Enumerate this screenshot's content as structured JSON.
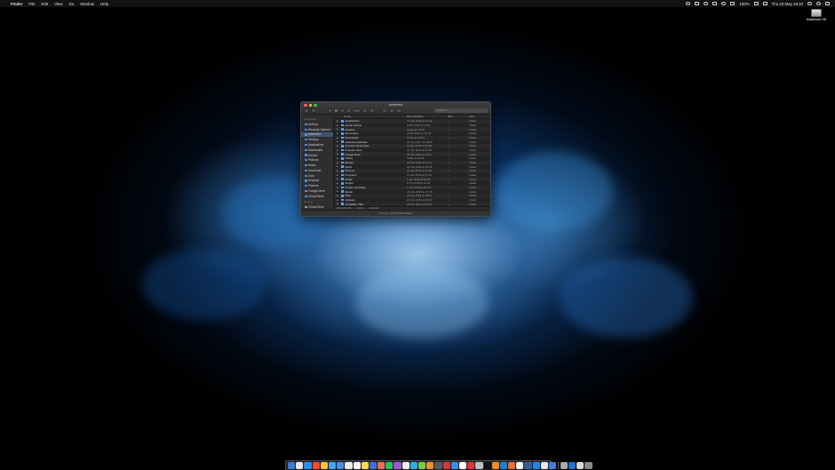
{
  "menubar": {
    "items": [
      "Finder",
      "File",
      "Edit",
      "View",
      "Go",
      "Window",
      "Help"
    ],
    "battery": "100%",
    "datetime": "Thu 23 May 18:10"
  },
  "desktop": {
    "drive_label": "Macintosh HD"
  },
  "finder": {
    "title": "abmerfert",
    "search_placeholder": "Search",
    "sidebar": {
      "favorites_label": "Favourites",
      "favorites": [
        "AirDrop",
        "Recently Opened",
        "abmerfert",
        "Desktop",
        "Applications",
        "Downloads",
        "Movies",
        "Pictures",
        "Music",
        "Download",
        "Dust",
        "Dropbox",
        "Pictures",
        "Google Drive",
        "iCloud Drive"
      ],
      "devices_label": "Devices",
      "devices": [
        "iCloud Drive",
        "Macintosh HD"
      ],
      "selected_index": 2
    },
    "columns": {
      "name": "Name",
      "date": "Date Modified",
      "size": "Size",
      "kind": "Kind"
    },
    "rows": [
      {
        "name": "Applications",
        "date": "17 Aug 2018 at 12:10",
        "size": "--",
        "kind": "Folder"
      },
      {
        "name": "Adobe Scripts",
        "date": "8 Mar 2019 at 10:37",
        "size": "--",
        "kind": "Folder"
      },
      {
        "name": "Desktop",
        "date": "Today at 18:03",
        "size": "--",
        "kind": "Folder"
      },
      {
        "name": "Documents",
        "date": "3 Mar 2019 at 11:18",
        "size": "--",
        "kind": "Folder"
      },
      {
        "name": "Downloads",
        "date": "Today at 18:04",
        "size": "--",
        "kind": "Folder"
      },
      {
        "name": "android-certificates",
        "date": "24 Sep 2017 at 18:03",
        "size": "--",
        "kind": "Folder"
      },
      {
        "name": "Creative Cloud Files",
        "date": "15 Apr 2018 at 22:59",
        "size": "--",
        "kind": "Folder"
      },
      {
        "name": "R Studio docs",
        "date": "21 Jan 2019 at 13:40",
        "size": "--",
        "kind": "Folder"
      },
      {
        "name": "Google Drive",
        "date": "25 Apr 2019 at 14:21",
        "size": "--",
        "kind": "Folder"
      },
      {
        "name": "Library",
        "date": "Today at 11:03",
        "size": "--",
        "kind": "Folder"
      },
      {
        "name": "Movies",
        "date": "23 Oct 2018 at 16:11",
        "size": "--",
        "kind": "Folder"
      },
      {
        "name": "Music",
        "date": "22 Feb 2019 at 10:28",
        "size": "--",
        "kind": "Folder"
      },
      {
        "name": "Pictures",
        "date": "19 Apr 2019 at 13:43",
        "size": "--",
        "kind": "Folder"
      },
      {
        "name": "Programs",
        "date": "11 Jan 2019 at 17:32",
        "size": "--",
        "kind": "Folder"
      },
      {
        "name": "Public",
        "date": "1 Apr 2018 at 20:09",
        "size": "--",
        "kind": "Folder"
      },
      {
        "name": "Scripts",
        "date": "8 Oct 2018 at 12:10",
        "size": "--",
        "kind": "Folder"
      },
      {
        "name": "Screen recording",
        "date": "3 Jan 2019 at 23:19",
        "size": "--",
        "kind": "Folder"
      },
      {
        "name": "Server",
        "date": "23 Feb 2019 at 17:15",
        "size": "--",
        "kind": "Folder"
      },
      {
        "name": "Sites",
        "date": "19 Apr 2019 at 18:02",
        "size": "--",
        "kind": "Folder"
      },
      {
        "name": "snippets",
        "date": "21 Nov 2018 at 09:40",
        "size": "--",
        "kind": "Folder"
      },
      {
        "name": "VirtualBox VMs",
        "date": "20 Jan 2019 at 09:31",
        "size": "--",
        "kind": "Folder"
      }
    ],
    "pathbar": [
      "Macintosh HD",
      "Users",
      "abmerfert"
    ],
    "status": "21 items, 68.11 GB available"
  },
  "dock": {
    "icon_colors": [
      "#3b7de0",
      "#e8e8e8",
      "#2c8ff0",
      "#f24a2b",
      "#f7c23a",
      "#3fa6f5",
      "#4c8be0",
      "#ececec",
      "#f5f5f5",
      "#ffd84a",
      "#3d6fe0",
      "#f06a5a",
      "#2fbf56",
      "#9b59d0",
      "#f0f0f0",
      "#2ab0e6",
      "#7ac943",
      "#e8922d",
      "#5a5a5a",
      "#d43838",
      "#3a8ee8",
      "#ffffff",
      "#e0353e",
      "#c0c0c0",
      "#111111",
      "#f28c28",
      "#1e7fd8",
      "#ef6b2e",
      "#f4f4f4",
      "#355d9b",
      "#1b8be5",
      "#e7e7e7",
      "#3f7fd8",
      "#aaaaaa",
      "#1f73d6",
      "#d9d9d9",
      "#8a8a8a"
    ],
    "separator_after": 32
  }
}
